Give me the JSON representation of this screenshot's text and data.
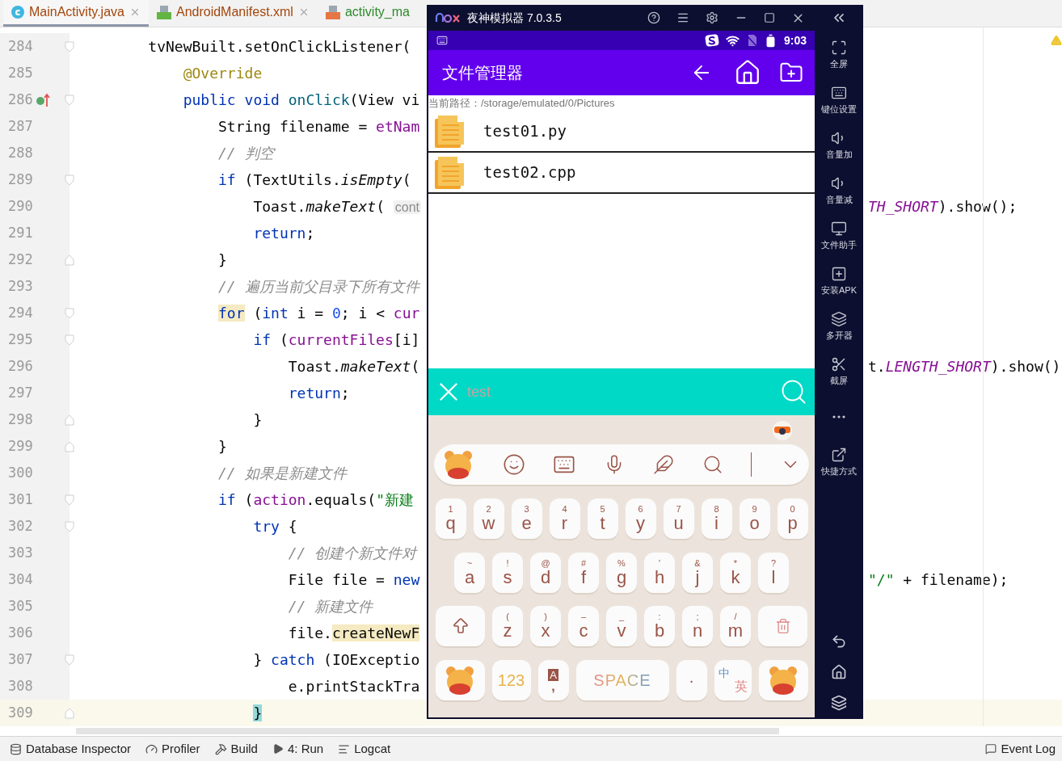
{
  "ide": {
    "tabs": [
      {
        "label": "MainActivity.java",
        "kind": "java",
        "selected": true
      },
      {
        "label": "AndroidManifest.xml",
        "kind": "manifest",
        "selected": false
      },
      {
        "label": "activity_ma",
        "kind": "layout",
        "selected": false
      }
    ],
    "lines": [
      {
        "number": "284",
        "gutter": [
          {
            "kind": "fold-start"
          }
        ],
        "current": false,
        "tokens": [
          {
            "kind": "plain",
            "text": "tvNewBuilt.setOnClickListener("
          }
        ],
        "children": [
          {
            "number": "285",
            "current": false,
            "tokens": [
              {
                "kind": "annotation",
                "text": "@Override"
              }
            ]
          },
          {
            "number": "286",
            "gutter": [
              {
                "kind": "override"
              },
              {
                "kind": "fold-start"
              }
            ],
            "current": false,
            "tokens": [
              {
                "kind": "keyword",
                "text": "public void "
              },
              {
                "kind": "declaration",
                "text": "onClick"
              },
              {
                "kind": "plain",
                "text": "(View vi"
              }
            ],
            "children": [
              {
                "number": "287",
                "current": false,
                "tokens": [
                  {
                    "kind": "plain",
                    "text": "String filename = "
                  },
                  {
                    "kind": "field",
                    "text": "etNam"
                  }
                ]
              },
              {
                "number": "288",
                "current": false,
                "tokens": [
                  {
                    "kind": "comment",
                    "text": "// 判空"
                  }
                ]
              },
              {
                "number": "289",
                "gutter": [
                  {
                    "kind": "fold-start"
                  }
                ],
                "current": false,
                "tokens": [
                  {
                    "kind": "keyword",
                    "text": "if "
                  },
                  {
                    "kind": "plain",
                    "text": "(TextUtils."
                  },
                  {
                    "kind": "method",
                    "text": "isEmpty"
                  },
                  {
                    "kind": "plain",
                    "text": "("
                  }
                ],
                "children": [
                  {
                    "number": "290",
                    "current": false,
                    "tokens": [
                      {
                        "kind": "plain",
                        "text": "Toast."
                      },
                      {
                        "kind": "method",
                        "text": "makeText"
                      },
                      {
                        "kind": "plain",
                        "text": "( "
                      },
                      {
                        "kind": "hint",
                        "text": "cont"
                      }
                    ],
                    "right": [
                      {
                        "kind": "static",
                        "text": "TH_SHORT"
                      },
                      {
                        "kind": "plain",
                        "text": ").show();"
                      }
                    ]
                  },
                  {
                    "number": "291",
                    "current": false,
                    "tokens": [
                      {
                        "kind": "keyword",
                        "text": "return"
                      },
                      {
                        "kind": "plain",
                        "text": ";"
                      }
                    ]
                  }
                ]
              },
              {
                "number": "292",
                "gutter": [
                  {
                    "kind": "fold-end"
                  }
                ],
                "current": false,
                "tokens": [
                  {
                    "kind": "plain",
                    "text": "}"
                  }
                ]
              },
              {
                "number": "293",
                "current": false,
                "tokens": [
                  {
                    "kind": "comment",
                    "text": "// 遍历当前父目录下所有文件"
                  }
                ]
              },
              {
                "number": "294",
                "gutter": [
                  {
                    "kind": "fold-start"
                  }
                ],
                "current": false,
                "tokens": [
                  {
                    "kind": "keyword-marked",
                    "text": "for"
                  },
                  {
                    "kind": "plain",
                    "text": " ("
                  },
                  {
                    "kind": "keyword",
                    "text": "int "
                  },
                  {
                    "kind": "plain",
                    "text": "i = "
                  },
                  {
                    "kind": "number",
                    "text": "0"
                  },
                  {
                    "kind": "plain",
                    "text": "; i < "
                  },
                  {
                    "kind": "field",
                    "text": "cur"
                  }
                ],
                "children": [
                  {
                    "number": "295",
                    "gutter": [
                      {
                        "kind": "fold-start"
                      }
                    ],
                    "current": false,
                    "tokens": [
                      {
                        "kind": "keyword",
                        "text": "if "
                      },
                      {
                        "kind": "plain",
                        "text": "("
                      },
                      {
                        "kind": "field",
                        "text": "currentFiles"
                      },
                      {
                        "kind": "plain",
                        "text": "[i]"
                      }
                    ],
                    "children": [
                      {
                        "number": "296",
                        "current": false,
                        "tokens": [
                          {
                            "kind": "plain",
                            "text": "Toast."
                          },
                          {
                            "kind": "method",
                            "text": "makeText"
                          },
                          {
                            "kind": "plain",
                            "text": "("
                          }
                        ],
                        "right": [
                          {
                            "kind": "plain",
                            "text": "t."
                          },
                          {
                            "kind": "static",
                            "text": "LENGTH_SHORT"
                          },
                          {
                            "kind": "plain",
                            "text": ").show()"
                          }
                        ]
                      },
                      {
                        "number": "297",
                        "current": false,
                        "tokens": [
                          {
                            "kind": "keyword",
                            "text": "return"
                          },
                          {
                            "kind": "plain",
                            "text": ";"
                          }
                        ]
                      }
                    ]
                  },
                  {
                    "number": "298",
                    "gutter": [
                      {
                        "kind": "fold-end"
                      }
                    ],
                    "current": false,
                    "tokens": [
                      {
                        "kind": "plain",
                        "text": "}"
                      }
                    ]
                  }
                ]
              },
              {
                "number": "299",
                "gutter": [
                  {
                    "kind": "fold-end"
                  }
                ],
                "current": false,
                "tokens": [
                  {
                    "kind": "plain",
                    "text": "}"
                  }
                ]
              },
              {
                "number": "300",
                "current": false,
                "tokens": [
                  {
                    "kind": "comment",
                    "text": "// 如果是新建文件"
                  }
                ]
              },
              {
                "number": "301",
                "gutter": [
                  {
                    "kind": "fold-start"
                  }
                ],
                "current": false,
                "tokens": [
                  {
                    "kind": "keyword",
                    "text": "if "
                  },
                  {
                    "kind": "plain",
                    "text": "("
                  },
                  {
                    "kind": "field",
                    "text": "action"
                  },
                  {
                    "kind": "plain",
                    "text": ".equals("
                  },
                  {
                    "kind": "string",
                    "text": "\"新建"
                  }
                ],
                "children": [
                  {
                    "number": "302",
                    "gutter": [
                      {
                        "kind": "fold-start"
                      }
                    ],
                    "current": false,
                    "tokens": [
                      {
                        "kind": "keyword",
                        "text": "try "
                      },
                      {
                        "kind": "plain",
                        "text": "{"
                      }
                    ],
                    "children": [
                      {
                        "number": "303",
                        "current": false,
                        "tokens": [
                          {
                            "kind": "comment",
                            "text": "// 创建个新文件对"
                          }
                        ]
                      },
                      {
                        "number": "304",
                        "current": false,
                        "tokens": [
                          {
                            "kind": "plain",
                            "text": "File file = "
                          },
                          {
                            "kind": "keyword",
                            "text": "new"
                          }
                        ],
                        "right": [
                          {
                            "kind": "string",
                            "text": "\"/\""
                          },
                          {
                            "kind": "plain",
                            "text": " + filename);"
                          }
                        ]
                      },
                      {
                        "number": "305",
                        "current": false,
                        "tokens": [
                          {
                            "kind": "comment",
                            "text": "// 新建文件"
                          }
                        ]
                      },
                      {
                        "number": "306",
                        "current": false,
                        "tokens": [
                          {
                            "kind": "plain",
                            "text": "file."
                          },
                          {
                            "kind": "plain-marked",
                            "text": "createNewF"
                          }
                        ]
                      }
                    ]
                  },
                  {
                    "number": "307",
                    "gutter": [
                      {
                        "kind": "fold-start"
                      }
                    ],
                    "current": false,
                    "tokens": [
                      {
                        "kind": "plain",
                        "text": "} "
                      },
                      {
                        "kind": "keyword",
                        "text": "catch "
                      },
                      {
                        "kind": "plain",
                        "text": "(IOExceptio"
                      }
                    ],
                    "children": [
                      {
                        "number": "308",
                        "current": false,
                        "tokens": [
                          {
                            "kind": "plain",
                            "text": "e.printStackTra"
                          }
                        ]
                      }
                    ]
                  },
                  {
                    "number": "309",
                    "gutter": [
                      {
                        "kind": "fold-end"
                      }
                    ],
                    "current": true,
                    "tokens": [
                      {
                        "kind": "bracket-marked",
                        "text": "}"
                      }
                    ]
                  }
                ]
              }
            ]
          }
        ]
      }
    ],
    "tools": [
      {
        "label": "Database Inspector",
        "kind": "database"
      },
      {
        "label": "Profiler",
        "kind": "profiler"
      },
      {
        "label": "Build",
        "kind": "build"
      },
      {
        "label": "4: Run",
        "kind": "run"
      },
      {
        "label": "Logcat",
        "kind": "logcat"
      }
    ],
    "event_log": "Event Log"
  },
  "emulator": {
    "title": "夜神模拟器 7.0.3.5",
    "sidebar": [
      {
        "label": "全屏",
        "kind": "fullscreen"
      },
      {
        "label": "键位设置",
        "kind": "keymap"
      },
      {
        "label": "音量加",
        "kind": "volume-up"
      },
      {
        "label": "音量减",
        "kind": "volume-down"
      },
      {
        "label": "文件助手",
        "kind": "files"
      },
      {
        "label": "安装APK",
        "kind": "apk"
      },
      {
        "label": "多开器",
        "kind": "multi"
      },
      {
        "label": "截屏",
        "kind": "screenshot"
      },
      {
        "kind": "more"
      },
      {
        "label": "快捷方式",
        "kind": "shortcut"
      }
    ],
    "phone": {
      "time": "9:03",
      "app_title": "文件管理器",
      "path": "当前路径：/storage/emulated/0/Pictures",
      "files": [
        {
          "name": "test01.py"
        },
        {
          "name": "test02.cpp"
        }
      ],
      "search": {
        "placeholder": "test"
      },
      "keyboard": {
        "rows": [
          {
            "keys": [
              {
                "kind": "letter",
                "label": "q",
                "hint": "1"
              },
              {
                "kind": "letter",
                "label": "w",
                "hint": "2"
              },
              {
                "kind": "letter",
                "label": "e",
                "hint": "3"
              },
              {
                "kind": "letter",
                "label": "r",
                "hint": "4"
              },
              {
                "kind": "letter",
                "label": "t",
                "hint": "5"
              },
              {
                "kind": "letter",
                "label": "y",
                "hint": "6"
              },
              {
                "kind": "letter",
                "label": "u",
                "hint": "7"
              },
              {
                "kind": "letter",
                "label": "i",
                "hint": "8"
              },
              {
                "kind": "letter",
                "label": "o",
                "hint": "9"
              },
              {
                "kind": "letter",
                "label": "p",
                "hint": "0"
              }
            ]
          },
          {
            "keys": [
              {
                "kind": "letter",
                "label": "a",
                "hint": "~"
              },
              {
                "kind": "letter",
                "label": "s",
                "hint": "!"
              },
              {
                "kind": "letter",
                "label": "d",
                "hint": "@"
              },
              {
                "kind": "letter",
                "label": "f",
                "hint": "#"
              },
              {
                "kind": "letter",
                "label": "g",
                "hint": "%"
              },
              {
                "kind": "letter",
                "label": "h",
                "hint": "'"
              },
              {
                "kind": "letter",
                "label": "j",
                "hint": "&"
              },
              {
                "kind": "letter",
                "label": "k",
                "hint": "*"
              },
              {
                "kind": "letter",
                "label": "l",
                "hint": "?"
              }
            ]
          },
          {
            "keys": [
              {
                "kind": "shift"
              },
              {
                "kind": "letter",
                "label": "z",
                "hint": "("
              },
              {
                "kind": "letter",
                "label": "x",
                "hint": ")"
              },
              {
                "kind": "letter",
                "label": "c",
                "hint": "–"
              },
              {
                "kind": "letter",
                "label": "v",
                "hint": "_"
              },
              {
                "kind": "letter",
                "label": "b",
                "hint": ":"
              },
              {
                "kind": "letter",
                "label": "n",
                "hint": ";"
              },
              {
                "kind": "letter",
                "label": "m",
                "hint": "/"
              },
              {
                "kind": "delete"
              }
            ]
          },
          {
            "keys": [
              {
                "kind": "mascot"
              },
              {
                "kind": "numbers",
                "label": "123"
              },
              {
                "kind": "symbol",
                "label": "A",
                "hint": ","
              },
              {
                "kind": "space",
                "label": "SPACE"
              },
              {
                "kind": "dot",
                "label": "·"
              },
              {
                "kind": "lang",
                "label": "中",
                "hint": "英"
              },
              {
                "kind": "mascot"
              }
            ]
          }
        ]
      }
    }
  }
}
